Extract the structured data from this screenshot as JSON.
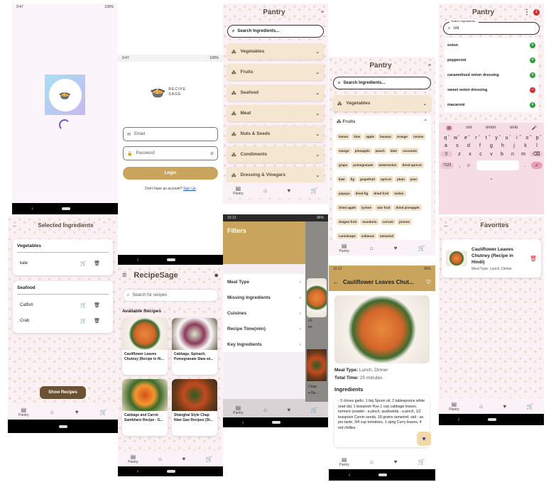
{
  "status": {
    "time1": "9:47",
    "time2": "10:12",
    "battery": "100%",
    "battery2": "96%"
  },
  "login": {
    "logo_line1": "RECIPE",
    "logo_line2": "SAGE",
    "email_placeholder": "Email",
    "password_placeholder": "Password",
    "login_button": "Login",
    "no_account": "Don't have an account?",
    "signup_link": "Sign Up"
  },
  "pantry": {
    "title": "Pantry",
    "search_placeholder": "Search Ingredients...",
    "categories": [
      "Vegetables",
      "Fruits",
      "Seafood",
      "Meat",
      "Nuts & Seeds",
      "Condiments",
      "Dressing & Vinegars"
    ]
  },
  "fruits": {
    "label": "Fruits",
    "chips": [
      "lemon",
      "lime",
      "apple",
      "banana",
      "orange",
      "raisins",
      "mango",
      "pineapple",
      "peach",
      "date",
      "coconuts",
      "grape",
      "pomegranate",
      "watermelon",
      "dried apricot",
      "kiwi",
      "fig",
      "grapefruit",
      "apricot",
      "plum",
      "pear",
      "papaya",
      "dried fig",
      "dried fruit",
      "melon",
      "dried apple",
      "lychee",
      "star fruit",
      "dried pineapple",
      "dragon fruit",
      "mandarin",
      "currant",
      "prunes",
      "cantaloupe",
      "sultanas",
      "tamarind"
    ]
  },
  "search_screen": {
    "label": "Search Ingredients...",
    "query": "oni",
    "badge": "1",
    "results": [
      {
        "name": "onion",
        "state": "add"
      },
      {
        "name": "pepperoni",
        "state": "add"
      },
      {
        "name": "caramelised onion dressing",
        "state": "add"
      },
      {
        "name": "sweet onion dressing",
        "state": "remove"
      },
      {
        "name": "macaroni",
        "state": "add"
      }
    ],
    "suggestions": [
      "oni",
      "onion",
      "onio"
    ]
  },
  "keyboard": {
    "row1": [
      "q",
      "w",
      "e",
      "r",
      "t",
      "y",
      "u",
      "i",
      "o",
      "p"
    ],
    "row1_nums": [
      "1",
      "2",
      "3",
      "4",
      "5",
      "6",
      "7",
      "8",
      "9",
      "0"
    ],
    "row2": [
      "a",
      "s",
      "d",
      "f",
      "g",
      "h",
      "j",
      "k",
      "l"
    ],
    "row3": [
      "z",
      "x",
      "c",
      "v",
      "b",
      "n",
      "m"
    ],
    "sym": "?123",
    "comma": ",",
    "dot": "."
  },
  "selected": {
    "title": "Selected Ingredients",
    "groups": [
      {
        "name": "Vegetables",
        "items": [
          "kale"
        ]
      },
      {
        "name": "Seafood",
        "items": [
          "Catfish",
          "Crab"
        ]
      }
    ],
    "show_button": "Show Recipes"
  },
  "home": {
    "title": "RecipeSage",
    "search_placeholder": "Search for recipes",
    "section": "Available Recipes",
    "recipes": [
      "Cauliflower Leaves Chutney (Recipe in Hi...",
      "Cabbage, Spinach, Pomegranate Slaw wi...",
      "Cabbage and Carrot Sambharo Recipe - G...",
      "Shanghai Style Chap Nian Gao Recipes (St..."
    ]
  },
  "filters": {
    "title": "Filters",
    "items": [
      "Meal Type",
      "Missing Ingredients",
      "Cuisines",
      "Recipe Time(min)",
      "Key Ingredients"
    ],
    "peek": [
      "ch,",
      "en",
      "Chap",
      "e Re..."
    ]
  },
  "detail": {
    "title": "Cauliflower Leaves Chut...",
    "meal_label": "Meal Type:",
    "meal_value": "Lunch, Dinner",
    "time_label": "Total Time:",
    "time_value": "25 minutes",
    "ingredients_label": "Ingredients",
    "ingredients_text": "- 3 cloves garlic, 1 big Spoon oil, 2 tablespoons white urad dal, 1 teaspoon Rye,1 cup cabbage leaves, turmeric powder - a pinch, asafoetida - a pinch, 1/2 teaspoon Cumin seeds, 18 grams tamarind, salt - as per taste, 3/4 cup tomatoes, 1 sprig Curry leaves, 4 red chillies"
  },
  "favorites": {
    "title": "Favorites",
    "item_title": "Cauliflower Leaves Chutney (Recipe in Hindi)",
    "item_meta": "Meal Type: Lunch, Dinner"
  },
  "nav": {
    "pantry": "Pantry"
  },
  "colors": {
    "accent": "#c9a45c",
    "dark_button": "#6b5234",
    "cream": "#f4e6d0",
    "red": "#d32f2f",
    "green": "#2e9e3c",
    "keyboard_bg": "#f6dce5"
  }
}
